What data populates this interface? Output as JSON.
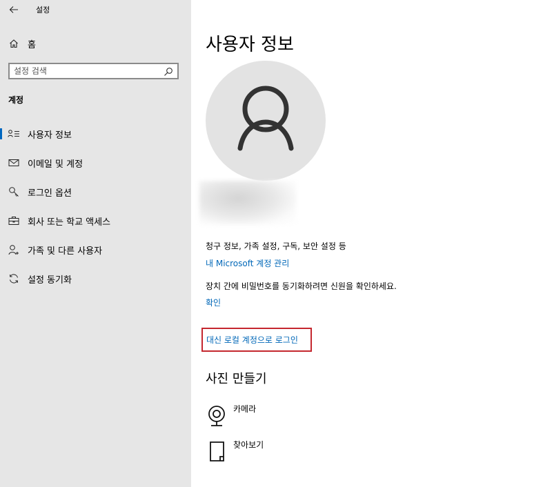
{
  "window": {
    "title": "설정"
  },
  "sidebar": {
    "home_label": "홈",
    "search_placeholder": "설정 검색",
    "section_heading": "계정",
    "items": [
      {
        "label": "사용자 정보",
        "icon": "user-info-icon",
        "selected": true
      },
      {
        "label": "이메일 및 계정",
        "icon": "mail-icon",
        "selected": false
      },
      {
        "label": "로그인 옵션",
        "icon": "key-icon",
        "selected": false
      },
      {
        "label": "회사 또는 학교 액세스",
        "icon": "briefcase-icon",
        "selected": false
      },
      {
        "label": "가족 및 다른 사용자",
        "icon": "person-add-icon",
        "selected": false
      },
      {
        "label": "설정 동기화",
        "icon": "sync-icon",
        "selected": false
      }
    ]
  },
  "main": {
    "title": "사용자 정보",
    "billing_text": "청구 정보, 가족 설정, 구독, 보안 설정 등",
    "manage_link": "내 Microsoft 계정 관리",
    "verify_text": "장치 간에 비밀번호를 동기화하려면 신원을 확인하세요.",
    "verify_link": "확인",
    "local_login_link": "대신 로컬 계정으로 로그인",
    "create_photo_title": "사진 만들기",
    "photo_options": [
      {
        "label": "카메라",
        "icon": "camera-icon"
      },
      {
        "label": "찾아보기",
        "icon": "browse-icon"
      }
    ]
  },
  "colors": {
    "sidebar_bg": "#e6e6e6",
    "accent": "#0067c0",
    "link": "#0067b8",
    "highlight_border": "#c4262e",
    "avatar_bg": "#e3e3e3"
  }
}
